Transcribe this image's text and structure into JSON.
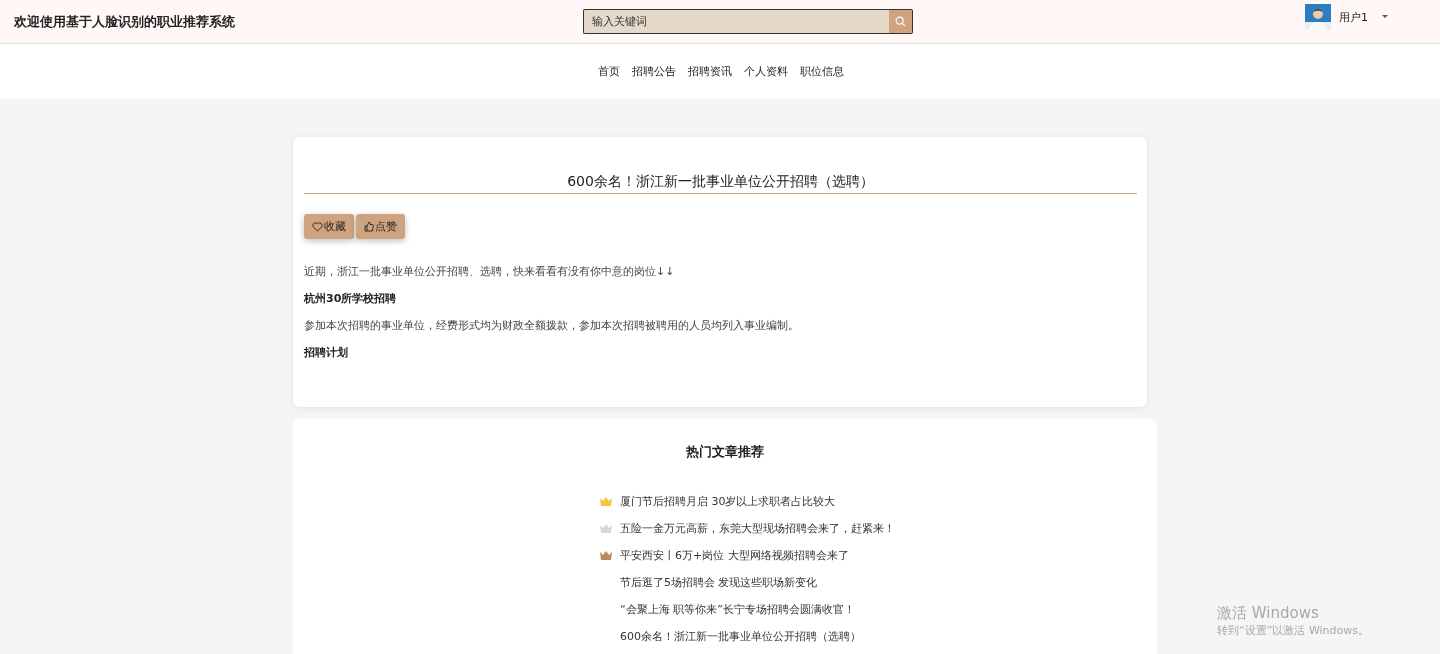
{
  "header": {
    "title": "欢迎使用基于人脸识别的职业推荐系统",
    "search": {
      "placeholder": "输入关键词"
    },
    "user": {
      "name": "用户1"
    }
  },
  "nav": [
    "首页",
    "招聘公告",
    "招聘资讯",
    "个人资料",
    "职位信息"
  ],
  "article": {
    "title": "600余名！浙江新一批事业单位公开招聘（选聘）",
    "buttons": [
      {
        "kind": "favorite",
        "label": "收藏"
      },
      {
        "kind": "like",
        "label": "点赞"
      }
    ],
    "paragraphs": [
      {
        "kind": "text",
        "text": "近期，浙江一批事业单位公开招聘、选聘，快来看看有没有你中意的岗位↓↓"
      },
      {
        "kind": "heading",
        "text": "杭州30所学校招聘"
      },
      {
        "kind": "text",
        "text": "参加本次招聘的事业单位，经费形式均为财政全额拨款，参加本次招聘被聘用的人员均列入事业编制。"
      },
      {
        "kind": "heading",
        "text": "招聘计划"
      }
    ]
  },
  "hot": {
    "title": "热门文章推荐",
    "items": [
      {
        "text": "厦门节后招聘月启 30岁以上求职者占比较大",
        "color": "#f5c542"
      },
      {
        "text": "五险一金万元高薪，东莞大型现场招聘会来了，赶紧来！",
        "color": "#d8d8d8"
      },
      {
        "text": "平安西安丨6万+岗位 大型网络视频招聘会来了",
        "color": "#b98a5a"
      },
      {
        "text": "节后逛了5场招聘会 发现这些职场新变化"
      },
      {
        "text": "“会聚上海 职等你来”长宁专场招聘会圆满收官！"
      },
      {
        "text": "600余名！浙江新一批事业单位公开招聘（选聘）"
      }
    ]
  },
  "activation": {
    "title": "激活 Windows",
    "subtitle": "转到“设置”以激活 Windows。"
  }
}
